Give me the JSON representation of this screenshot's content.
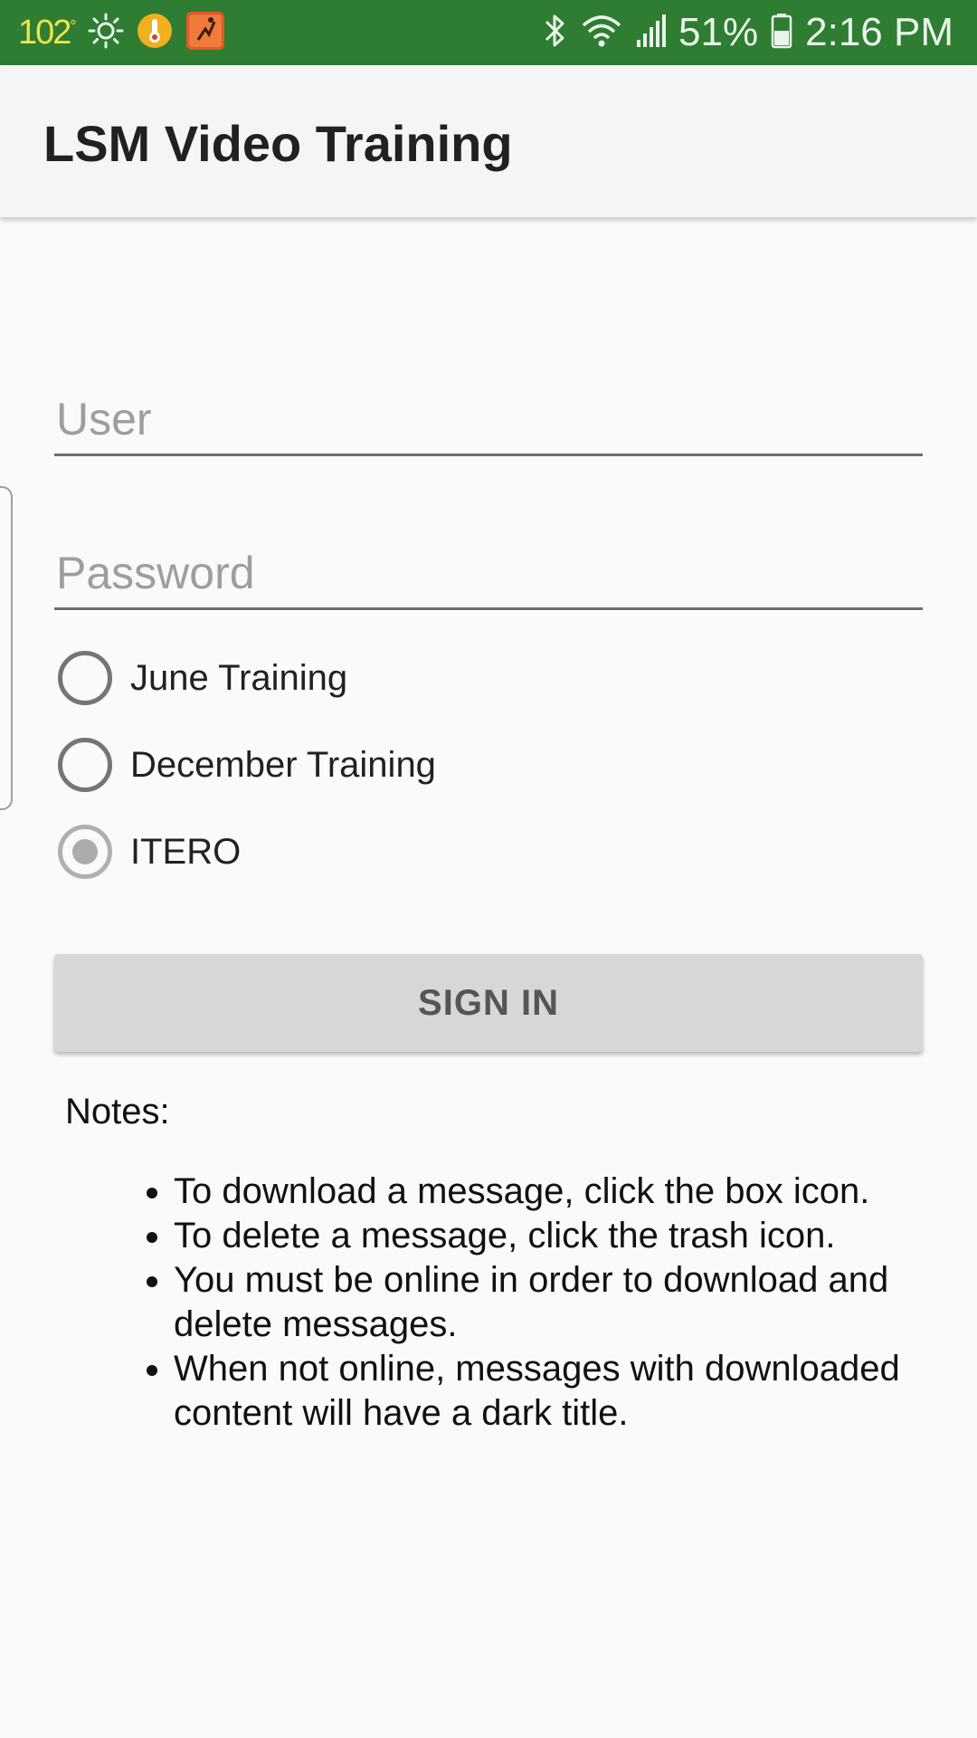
{
  "status_bar": {
    "temperature": "102",
    "temperature_unit": "°",
    "battery": "51%",
    "time": "2:16 PM",
    "icons": [
      "sun-icon",
      "thermometer-icon",
      "app-notification-icon",
      "bluetooth-icon",
      "wifi-icon",
      "signal-icon",
      "battery-icon"
    ],
    "background_color": "#2e7d32"
  },
  "app_bar": {
    "title": "LSM Video Training"
  },
  "form": {
    "user_placeholder": "User",
    "user_value": "",
    "password_placeholder": "Password",
    "password_value": ""
  },
  "radios": [
    {
      "label": "June Training",
      "checked": false
    },
    {
      "label": "December Training",
      "checked": false
    },
    {
      "label": "ITERO",
      "checked": true
    }
  ],
  "sign_in_label": "SIGN IN",
  "notes": {
    "heading": "Notes:",
    "items": [
      "To download a message, click the box icon.",
      "To delete a message, click the trash icon.",
      "You must be online in order to download and delete messages.",
      "When not online, messages with downloaded content will have a dark title."
    ]
  }
}
